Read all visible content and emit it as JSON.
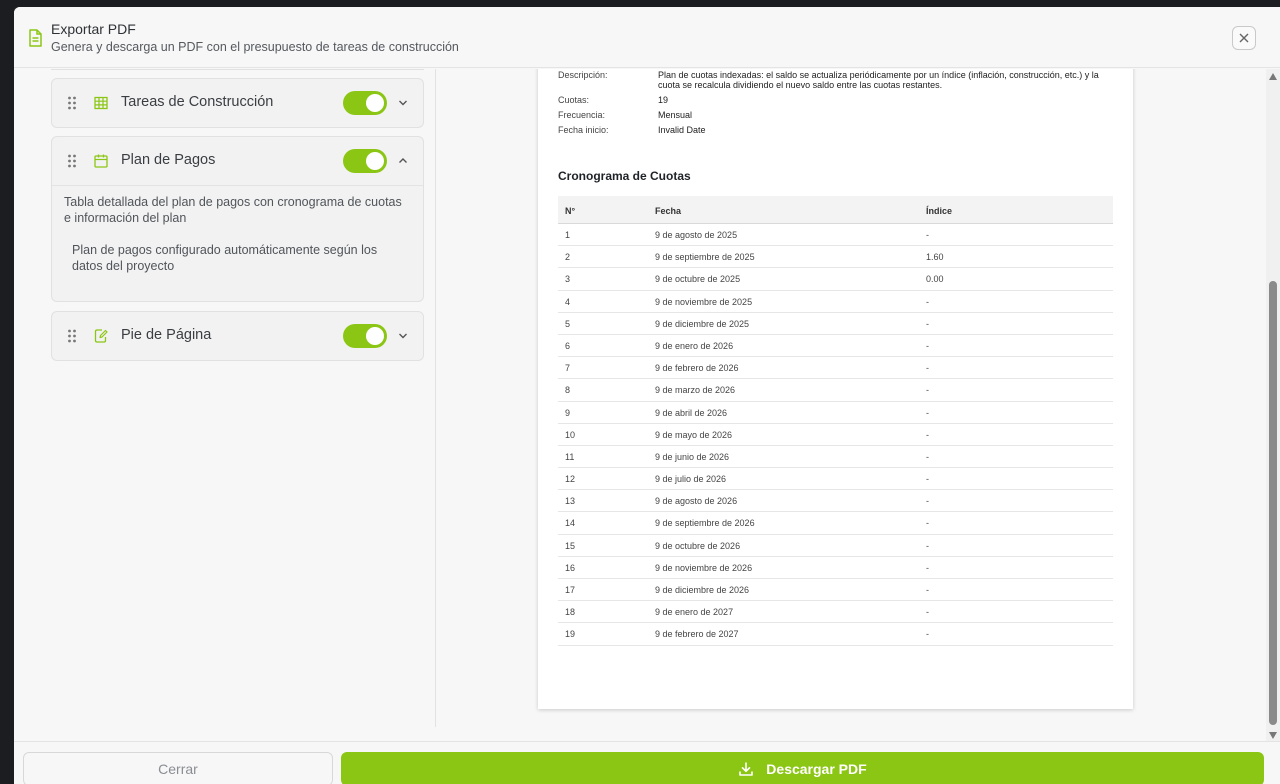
{
  "header": {
    "title": "Exportar PDF",
    "subtitle": "Genera y descarga un PDF con el presupuesto de tareas de construcción"
  },
  "sections": [
    {
      "title": "Tareas de Construcción",
      "enabled": true,
      "expanded": false,
      "icon": "table-icon"
    },
    {
      "title": "Plan de Pagos",
      "enabled": true,
      "expanded": true,
      "icon": "calendar-icon",
      "description": "Tabla detallada del plan de pagos con cronograma de cuotas e información del plan",
      "note": "Plan de pagos configurado automáticamente según los datos del proyecto"
    },
    {
      "title": "Pie de Página",
      "enabled": true,
      "expanded": false,
      "icon": "edit-document-icon"
    }
  ],
  "preview": {
    "info": {
      "desc_label": "Descripción:",
      "desc_value": "Plan de cuotas indexadas: el saldo se actualiza periódicamente por un índice (inflación, construcción, etc.) y la cuota se recalcula dividiendo el nuevo saldo entre las cuotas restantes.",
      "cuotas_label": "Cuotas:",
      "cuotas_value": "19",
      "freq_label": "Frecuencia:",
      "freq_value": "Mensual",
      "start_label": "Fecha inicio:",
      "start_value": "Invalid Date"
    },
    "schedule_title": "Cronograma de Cuotas",
    "columns": [
      "N°",
      "Fecha",
      "Índice"
    ],
    "rows": [
      [
        "1",
        "9 de agosto de 2025",
        "-"
      ],
      [
        "2",
        "9 de septiembre de 2025",
        "1.60"
      ],
      [
        "3",
        "9 de octubre de 2025",
        "0.00"
      ],
      [
        "4",
        "9 de noviembre de 2025",
        "-"
      ],
      [
        "5",
        "9 de diciembre de 2025",
        "-"
      ],
      [
        "6",
        "9 de enero de 2026",
        "-"
      ],
      [
        "7",
        "9 de febrero de 2026",
        "-"
      ],
      [
        "8",
        "9 de marzo de 2026",
        "-"
      ],
      [
        "9",
        "9 de abril de 2026",
        "-"
      ],
      [
        "10",
        "9 de mayo de 2026",
        "-"
      ],
      [
        "11",
        "9 de junio de 2026",
        "-"
      ],
      [
        "12",
        "9 de julio de 2026",
        "-"
      ],
      [
        "13",
        "9 de agosto de 2026",
        "-"
      ],
      [
        "14",
        "9 de septiembre de 2026",
        "-"
      ],
      [
        "15",
        "9 de octubre de 2026",
        "-"
      ],
      [
        "16",
        "9 de noviembre de 2026",
        "-"
      ],
      [
        "17",
        "9 de diciembre de 2026",
        "-"
      ],
      [
        "18",
        "9 de enero de 2027",
        "-"
      ],
      [
        "19",
        "9 de febrero de 2027",
        "-"
      ]
    ]
  },
  "footer": {
    "close_label": "Cerrar",
    "download_label": "Descargar PDF"
  },
  "colors": {
    "accent": "#8cc614",
    "background": "#f7f7f7"
  }
}
